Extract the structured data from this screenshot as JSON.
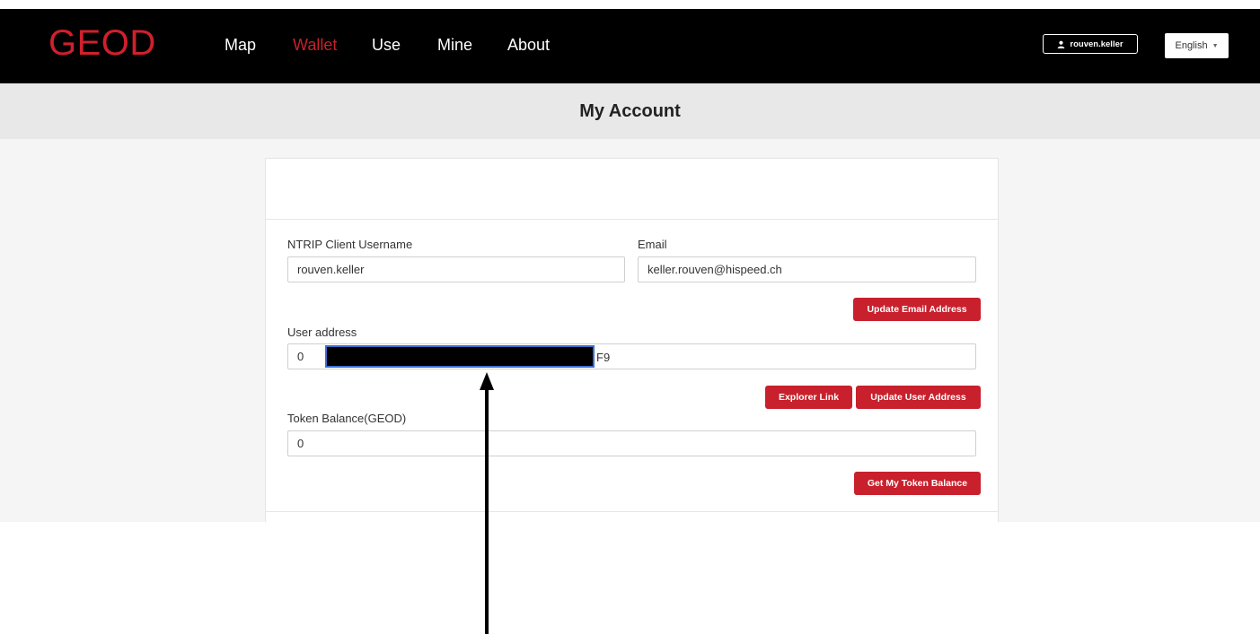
{
  "brand": "GEOD",
  "nav": {
    "items": [
      "Map",
      "Wallet",
      "Use",
      "Mine",
      "About"
    ],
    "active": "Wallet"
  },
  "user_button": {
    "label": "rouven.keller",
    "icon": "user-icon"
  },
  "language": {
    "selected": "English",
    "icon": "caret-down-icon"
  },
  "page_title": "My Account",
  "form": {
    "ntrip_label": "NTRIP Client Username",
    "ntrip_value": "rouven.keller",
    "email_label": "Email",
    "email_value": "keller.rouven@hispeed.ch",
    "update_email_button": "Update Email Address",
    "user_address_label": "User address",
    "user_address_prefix": "0",
    "user_address_suffix": "F9",
    "explorer_button": "Explorer Link",
    "update_address_button": "Update User Address",
    "token_label": "Token Balance(GEOD)",
    "token_value": "0",
    "token_button": "Get My Token Balance"
  },
  "colors": {
    "accent": "#c8202c",
    "navbar": "#000000",
    "title_bar": "#e8e8e8"
  }
}
